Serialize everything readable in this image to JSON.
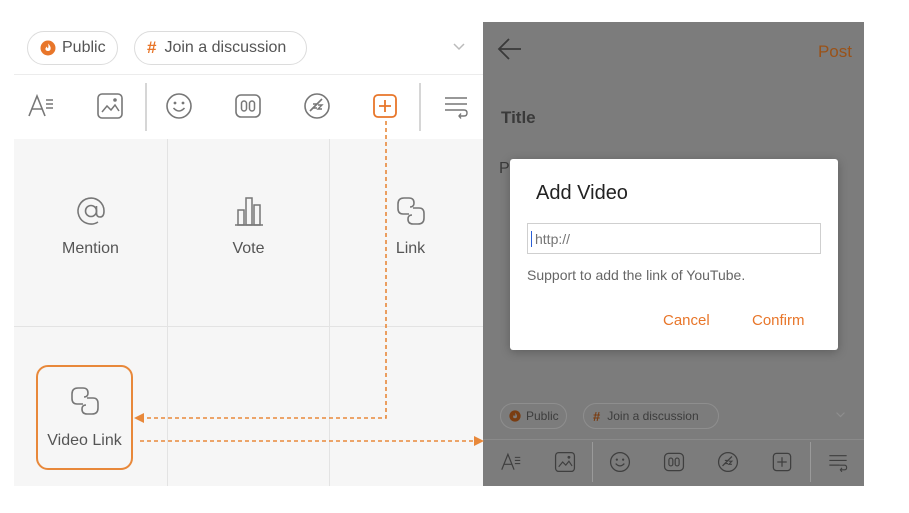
{
  "composer": {
    "audience_chip": "Public",
    "topic_chip": "Join a discussion",
    "panel_items": [
      {
        "label": "Mention"
      },
      {
        "label": "Vote"
      },
      {
        "label": "Link"
      }
    ],
    "video_link_label": "Video Link"
  },
  "editor": {
    "post_button": "Post",
    "title_placeholder": "Title",
    "body_placeholder": "P",
    "audience_chip": "Public",
    "topic_chip": "Join a discussion"
  },
  "dialog": {
    "title": "Add Video",
    "input_placeholder": "http://",
    "hint": "Support to add the link of YouTube.",
    "cancel": "Cancel",
    "confirm": "Confirm"
  },
  "colors": {
    "accent": "#e8762a",
    "annotation": "#e8883a",
    "overlay": "#7c7c7c"
  }
}
